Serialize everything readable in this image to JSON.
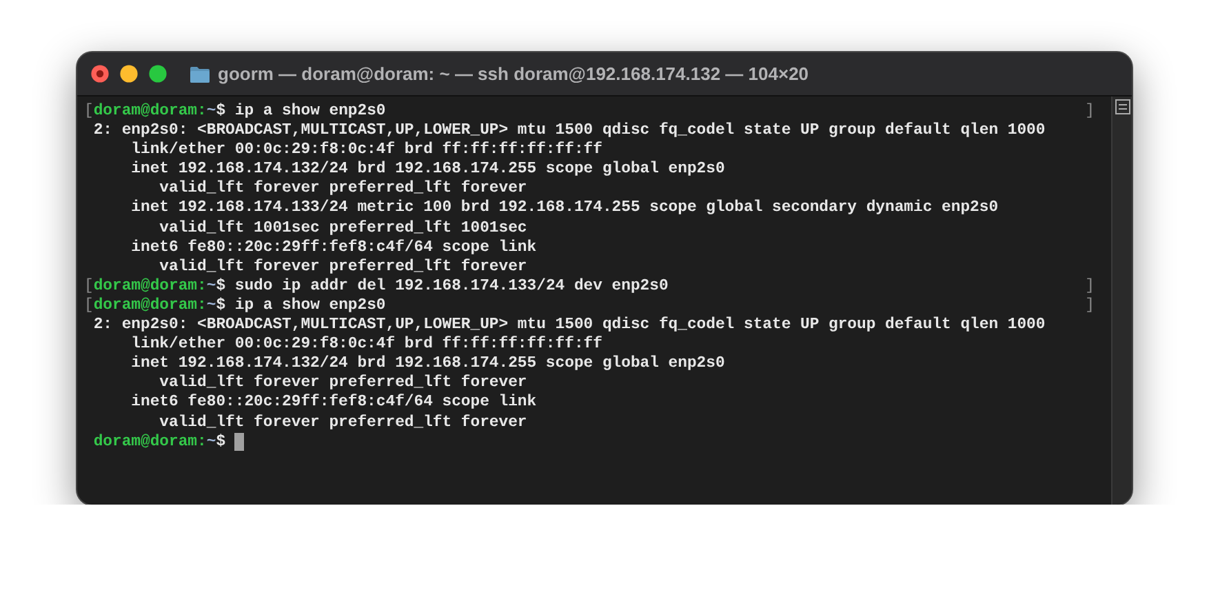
{
  "window": {
    "title": "goorm — doram@doram: ~ — ssh doram@192.168.174.132 — 104×20"
  },
  "terminal": {
    "lines": [
      {
        "kind": "prompt",
        "open": "[",
        "user": "doram@doram:",
        "path": "~",
        "symbol": "$",
        "command": "ip a show enp2s0",
        "close": "]"
      },
      {
        "kind": "output",
        "text": "2: enp2s0: <BROADCAST,MULTICAST,UP,LOWER_UP> mtu 1500 qdisc fq_codel state UP group default qlen 1000"
      },
      {
        "kind": "output",
        "text": "    link/ether 00:0c:29:f8:0c:4f brd ff:ff:ff:ff:ff:ff"
      },
      {
        "kind": "output",
        "text": "    inet 192.168.174.132/24 brd 192.168.174.255 scope global enp2s0"
      },
      {
        "kind": "output",
        "text": "       valid_lft forever preferred_lft forever"
      },
      {
        "kind": "output",
        "text": "    inet 192.168.174.133/24 metric 100 brd 192.168.174.255 scope global secondary dynamic enp2s0"
      },
      {
        "kind": "output",
        "text": "       valid_lft 1001sec preferred_lft 1001sec"
      },
      {
        "kind": "output",
        "text": "    inet6 fe80::20c:29ff:fef8:c4f/64 scope link"
      },
      {
        "kind": "output",
        "text": "       valid_lft forever preferred_lft forever"
      },
      {
        "kind": "prompt",
        "open": "[",
        "user": "doram@doram:",
        "path": "~",
        "symbol": "$",
        "command": "sudo ip addr del 192.168.174.133/24 dev enp2s0",
        "close": "]"
      },
      {
        "kind": "prompt",
        "open": "[",
        "user": "doram@doram:",
        "path": "~",
        "symbol": "$",
        "command": "ip a show enp2s0",
        "close": "]"
      },
      {
        "kind": "output",
        "text": "2: enp2s0: <BROADCAST,MULTICAST,UP,LOWER_UP> mtu 1500 qdisc fq_codel state UP group default qlen 1000"
      },
      {
        "kind": "output",
        "text": "    link/ether 00:0c:29:f8:0c:4f brd ff:ff:ff:ff:ff:ff"
      },
      {
        "kind": "output",
        "text": "    inet 192.168.174.132/24 brd 192.168.174.255 scope global enp2s0"
      },
      {
        "kind": "output",
        "text": "       valid_lft forever preferred_lft forever"
      },
      {
        "kind": "output",
        "text": "    inet6 fe80::20c:29ff:fef8:c4f/64 scope link"
      },
      {
        "kind": "output",
        "text": "       valid_lft forever preferred_lft forever"
      },
      {
        "kind": "prompt",
        "user": "doram@doram:",
        "path": "~",
        "symbol": "$",
        "cursor": true
      }
    ]
  }
}
